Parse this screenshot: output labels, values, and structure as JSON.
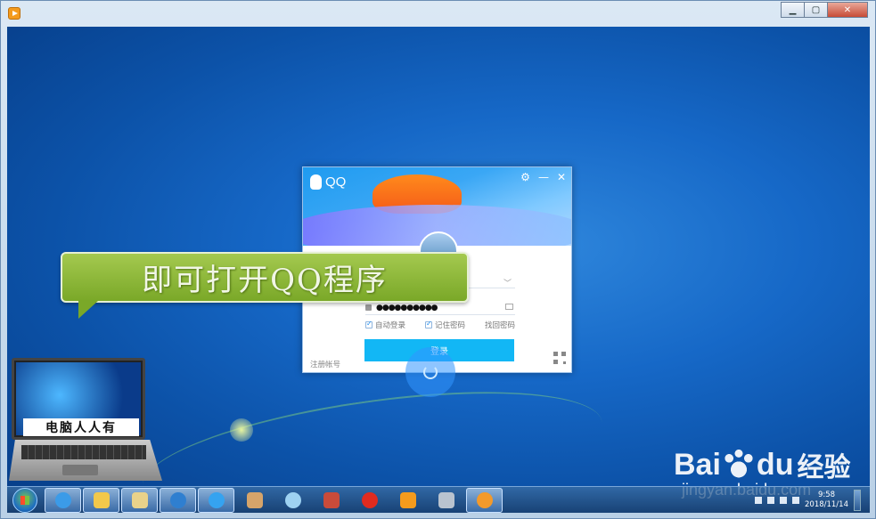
{
  "bubble": {
    "text": "即可打开QQ程序"
  },
  "laptop": {
    "label": "电脑人人有"
  },
  "qq": {
    "title": "QQ",
    "password_mask": "●●●●●●●●●●",
    "auto_login": "自动登录",
    "remember_password": "记住密码",
    "find_password": "找回密码",
    "login_button": "登录",
    "register": "注册帐号",
    "dropdown": "﹀"
  },
  "baidu": {
    "text_bai": "Bai",
    "text_du": "du",
    "text_cn": "经验",
    "url": "jingyan.baidu.com"
  },
  "taskbar": {
    "time": "9:58",
    "date": "2018/11/14",
    "icons": [
      "internet-explorer",
      "folder",
      "file-manager",
      "media-center",
      "qq-browser",
      "paint",
      "pinwheel",
      "tools",
      "jiang-chess",
      "video-player",
      "network-drive",
      "qq-penguin"
    ]
  },
  "window": {
    "minimize": "▁",
    "maximize": "▢",
    "close": "✕"
  },
  "colors": {
    "bubble_green": "#8ab73a",
    "qq_blue": "#12b7f5",
    "desktop_blue": "#1668c7"
  }
}
